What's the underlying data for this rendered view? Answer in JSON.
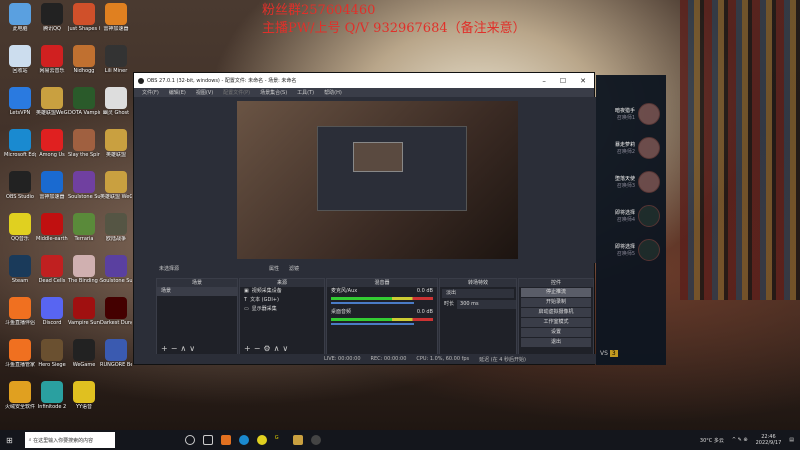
{
  "promo": {
    "line1": "粉丝群257604460",
    "line2": "主播PW/上号 Q/V 932967684（备注来意）"
  },
  "desktop_icons": [
    {
      "label": "此电脑",
      "color": "#5aa0e0"
    },
    {
      "label": "腾讯QQ",
      "color": "#222"
    },
    {
      "label": "Just Shapes & Beats",
      "color": "#d0502a"
    },
    {
      "label": "雷神加速器",
      "color": "#e08020"
    },
    {
      "label": "回收站",
      "color": "#cde"
    },
    {
      "label": "网易云音乐",
      "color": "#d02020"
    },
    {
      "label": "Nidhogg",
      "color": "#c07030"
    },
    {
      "label": "Lili Miner",
      "color": "#333"
    },
    {
      "label": "LetsVPN",
      "color": "#2a7ae0"
    },
    {
      "label": "英雄联盟WeGame版",
      "color": "#c9a040"
    },
    {
      "label": "DOTA Vampire",
      "color": "#2a5a2a"
    },
    {
      "label": "幽灵 Ghost",
      "color": "#ddd"
    },
    {
      "label": "Microsoft Edge",
      "color": "#1a8ad0"
    },
    {
      "label": "Among Us",
      "color": "#e02020"
    },
    {
      "label": "Slay the Spire",
      "color": "#a06040"
    },
    {
      "label": "英雄联盟",
      "color": "#c9a040"
    },
    {
      "label": "OBS Studio",
      "color": "#222"
    },
    {
      "label": "雷神加速器",
      "color": "#1a6ad0"
    },
    {
      "label": "Soulstone Survivors",
      "color": "#7040a0"
    },
    {
      "label": "英雄联盟 WeGame",
      "color": "#c9a040"
    },
    {
      "label": "QQ音乐",
      "color": "#e0d020"
    },
    {
      "label": "Middle-earth Shadow",
      "color": "#c01010"
    },
    {
      "label": "Terraria",
      "color": "#5a8a3a"
    },
    {
      "label": "欧陆战争",
      "color": "#554"
    },
    {
      "label": "Steam",
      "color": "#1a3a5a"
    },
    {
      "label": "Dead Cells",
      "color": "#c02020"
    },
    {
      "label": "The Binding of Isaac R...",
      "color": "#d0b0b0"
    },
    {
      "label": "Soulstone Survivors",
      "color": "#5a40a0"
    },
    {
      "label": "斗鱼直播伴侣",
      "color": "#f07020"
    },
    {
      "label": "Discord",
      "color": "#5865f2"
    },
    {
      "label": "Vampire Survivors",
      "color": "#a01010"
    },
    {
      "label": "Darkest Dungeon®",
      "color": "#400"
    },
    {
      "label": "斗鱼直播管家",
      "color": "#f07020"
    },
    {
      "label": "Hero Siege",
      "color": "#6a5030"
    },
    {
      "label": "WeGame",
      "color": "#222"
    },
    {
      "label": "RUNGORE Beginner...",
      "color": "#3a5ab0"
    },
    {
      "label": "火绒安全软件",
      "color": "#e0a020"
    },
    {
      "label": "Infinitode 2",
      "color": "#2aa0a0"
    },
    {
      "label": "YY语音",
      "color": "#e0c020"
    }
  ],
  "obs": {
    "title": "OBS 27.0.1 (32-bit, windows) - 配置文件: 未命名 - 场景: 未命名",
    "menu": [
      "文件(F)",
      "编辑(E)",
      "视图(V)",
      "配置文件(P)",
      "场景集合(S)",
      "工具(T)",
      "帮助(H)"
    ],
    "no_source": "未选择源",
    "properties": "属性",
    "filters": "滤镜",
    "scenes": {
      "header": "场景",
      "items": [
        "场景"
      ]
    },
    "sources": {
      "header": "来源",
      "items": [
        "视频采集设备",
        "文本 (GDI+)",
        "显示器采集"
      ]
    },
    "mixer": {
      "header": "混音器",
      "channels": [
        {
          "name": "麦克风/Aux",
          "db": "0.0 dB",
          "level": 0.6
        },
        {
          "name": "桌面音频",
          "db": "0.0 dB",
          "level": 0.7
        }
      ]
    },
    "transitions": {
      "header": "转场特效",
      "type": "淡出",
      "duration_label": "时长",
      "duration": "300 ms"
    },
    "controls": {
      "header": "控件",
      "buttons": [
        "停止推流",
        "开始录制",
        "启动虚拟摄像机",
        "工作室模式",
        "设置",
        "退出"
      ]
    },
    "status": {
      "live": "LIVE: 00:00:00",
      "rec": "REC: 00:00:00",
      "cpu": "CPU: 1.0%, 60.00 fps",
      "delay": "延迟 (在 4 秒后开始)"
    }
  },
  "lol": {
    "players": [
      {
        "name": "暗夜猎手",
        "sub": "召唤师1"
      },
      {
        "name": "暴走萝莉",
        "sub": "召唤师2"
      },
      {
        "name": "堕落天使",
        "sub": "召唤师3"
      },
      {
        "name": "即将选择",
        "sub": "召唤师4"
      },
      {
        "name": "即将选择",
        "sub": "召唤师5"
      }
    ],
    "vs": "VS",
    "badge": "3"
  },
  "taskbar": {
    "search_placeholder": "在这里输入你要搜索的内容",
    "weather": "30°C 多云",
    "time": "22:46",
    "date": "2022/9/17"
  }
}
